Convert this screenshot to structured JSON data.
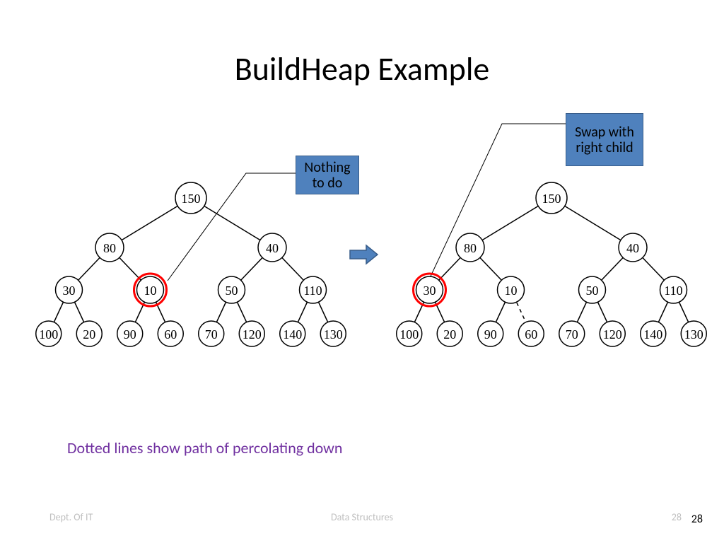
{
  "title": "BuildHeap Example",
  "callouts": {
    "nothing": "Nothing\nto do",
    "swap": "Swap\nwith right\nchild"
  },
  "caption": "Dotted lines show path of percolating down",
  "footer": {
    "left": "Dept. Of  IT",
    "center": "Data Structures",
    "right_gray": "28",
    "page": "28"
  },
  "trees": {
    "left": {
      "values": [
        150,
        80,
        40,
        30,
        10,
        50,
        110,
        100,
        20,
        90,
        60,
        70,
        120,
        140,
        130
      ],
      "highlight_index": 4,
      "dashed_edges": []
    },
    "right": {
      "values": [
        150,
        80,
        40,
        30,
        10,
        50,
        110,
        100,
        20,
        90,
        60,
        70,
        120,
        140,
        130
      ],
      "highlight_index": 3,
      "dashed_edges": [
        [
          4,
          10
        ]
      ]
    }
  }
}
